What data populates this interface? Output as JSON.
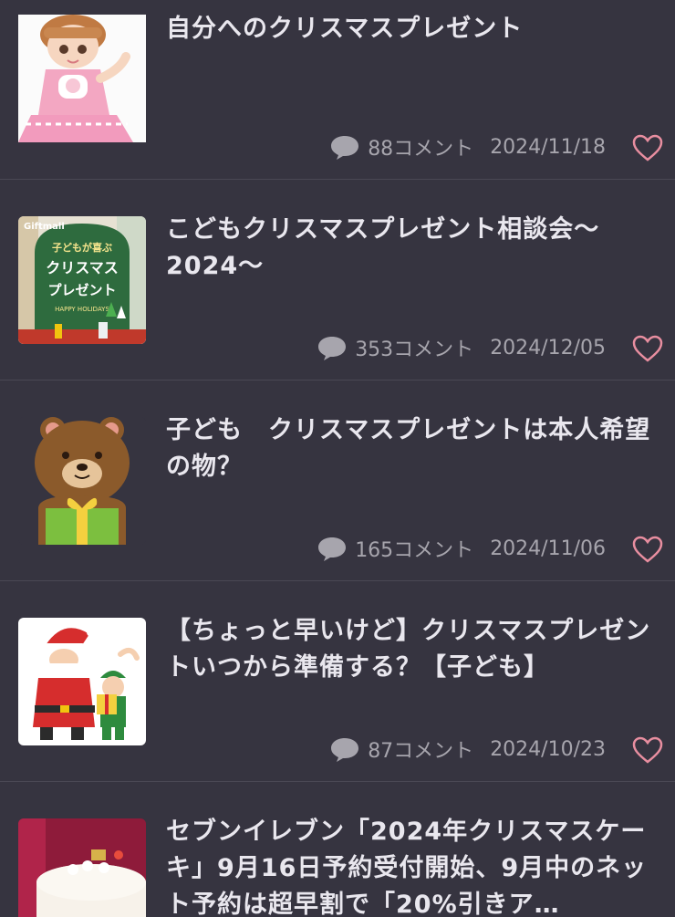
{
  "articles": [
    {
      "title": "自分へのクリスマスプレゼント",
      "comments": "88コメント",
      "date": "2024/11/18",
      "thumb_icon": "doll-photo"
    },
    {
      "title": "こどもクリスマスプレゼント相談会〜2024〜",
      "comments": "353コメント",
      "date": "2024/12/05",
      "thumb_icon": "giftmall-banner",
      "thumb_text": {
        "brand": "Giftmall",
        "line1": "子どもが喜ぶ",
        "line2": "クリスマス",
        "line3": "プレゼント",
        "line4": "HAPPY HOLIDAYS"
      }
    },
    {
      "title": "子ども　クリスマスプレゼントは本人希望の物？",
      "comments": "165コメント",
      "date": "2024/11/06",
      "thumb_icon": "bear-with-gift-illustration"
    },
    {
      "title": "【ちょっと早いけど】クリスマスプレゼントいつから準備する？【子ども】",
      "comments": "87コメント",
      "date": "2024/10/23",
      "thumb_icon": "santa-and-elf-illustration"
    },
    {
      "title": "セブンイレブン「2024年クリスマスケーキ」9月16日予約受付開始、9月中のネット予約は超早割で「20%引きア…",
      "thumb_icon": "christmas-cake-photo"
    }
  ],
  "colors": {
    "background": "#363440",
    "divider": "#4a4854",
    "title": "#e9e7ee",
    "meta": "#a7a5ad",
    "heart": "#e88ea0"
  },
  "icons": {
    "comment": "speech-bubble-icon",
    "like": "heart-outline-icon"
  }
}
